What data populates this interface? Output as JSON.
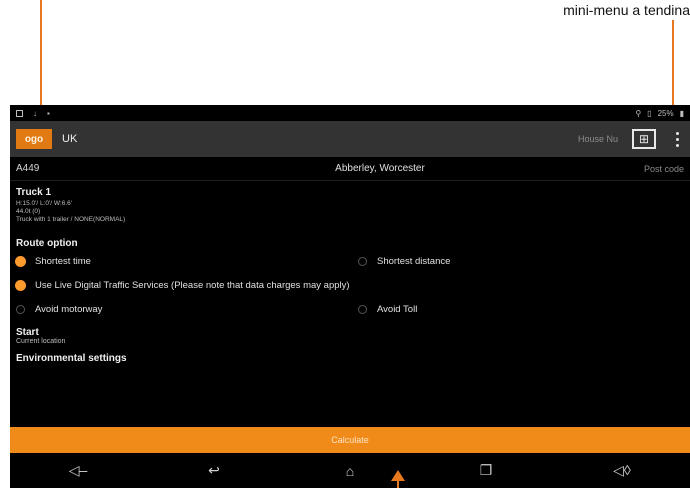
{
  "caption": "mini-menu a tendina",
  "colors": {
    "accent": "#f08a18",
    "arrow": "#e8781e",
    "background": "#000000",
    "appbar": "#333333"
  },
  "status_bar": {
    "battery": "25%",
    "icons": [
      "notification-icon",
      "download-icon",
      "location-icon",
      "battery-icon"
    ]
  },
  "app_bar": {
    "logo_text": "ogo",
    "country": "UK",
    "house_placeholder": "House Nu",
    "map_icon": "map-icon",
    "menu_icon": "overflow-menu-icon"
  },
  "address_row": {
    "road": "A449",
    "place": "Abberley, Worcester",
    "postcode_placeholder": "Post code"
  },
  "truck": {
    "title": "Truck 1",
    "lines": [
      "H:15.0'/ L:0'/ W:6.6'",
      "44.0t (0)",
      "Truck with 1 trailer / NONE(NORMAL)"
    ]
  },
  "route": {
    "title": "Route option",
    "options": [
      {
        "label": "Shortest time",
        "selected": true
      },
      {
        "label": "Shortest distance",
        "selected": false
      },
      {
        "label": "Use Live Digital Traffic Services (Please note that data charges may apply)",
        "selected": true
      },
      {
        "label": "Avoid motorway",
        "selected": false
      },
      {
        "label": "Avoid Toll",
        "selected": false
      }
    ]
  },
  "start": {
    "title": "Start",
    "value": "Current location"
  },
  "environmental": {
    "title": "Environmental settings"
  },
  "calculate_label": "Calculate",
  "nav_bar": {
    "icons": [
      "volume-down-icon",
      "back-icon",
      "home-icon",
      "recent-apps-icon",
      "volume-up-icon"
    ]
  }
}
